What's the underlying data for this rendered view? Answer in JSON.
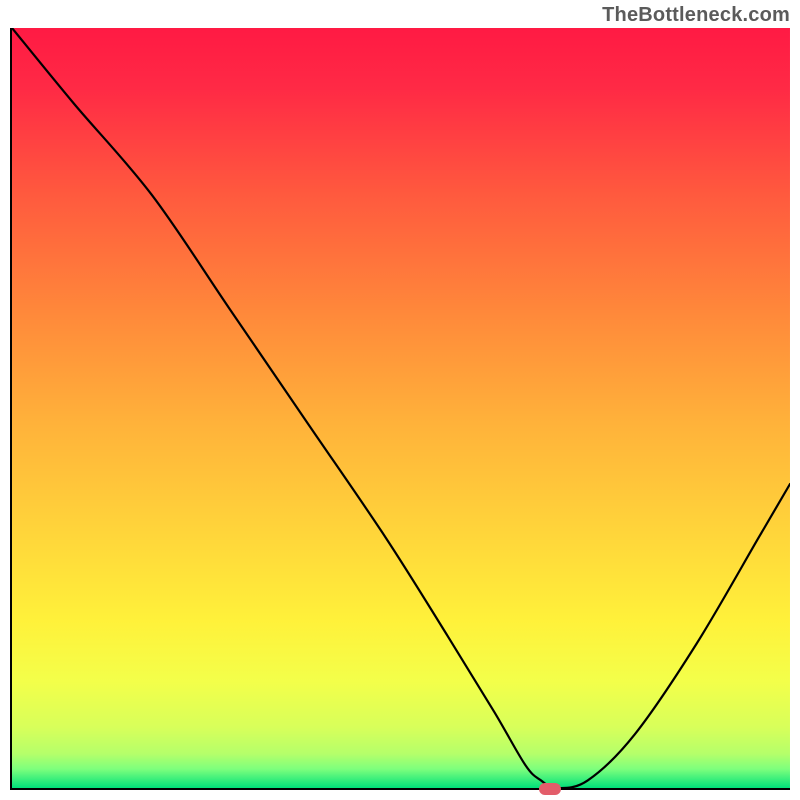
{
  "watermark": "TheBottleneck.com",
  "chart_data": {
    "type": "line",
    "title": "",
    "xlabel": "",
    "ylabel": "",
    "xlim": [
      0,
      100
    ],
    "ylim": [
      0,
      100
    ],
    "x": [
      0,
      8,
      18,
      28,
      38,
      48,
      56,
      62,
      66,
      68,
      70,
      74,
      80,
      88,
      96,
      100
    ],
    "values": [
      100,
      90,
      78,
      63,
      48,
      33,
      20,
      10,
      3,
      1,
      0,
      1,
      7,
      19,
      33,
      40
    ],
    "curve_smoothness": "smooth",
    "gradient_stops": [
      {
        "pos": 0.0,
        "color": "#ff1a44"
      },
      {
        "pos": 0.08,
        "color": "#ff2a45"
      },
      {
        "pos": 0.22,
        "color": "#ff5a3e"
      },
      {
        "pos": 0.38,
        "color": "#ff8a3a"
      },
      {
        "pos": 0.52,
        "color": "#ffb23a"
      },
      {
        "pos": 0.66,
        "color": "#ffd43a"
      },
      {
        "pos": 0.78,
        "color": "#fff13a"
      },
      {
        "pos": 0.86,
        "color": "#f3ff4a"
      },
      {
        "pos": 0.92,
        "color": "#d8ff5a"
      },
      {
        "pos": 0.955,
        "color": "#b5ff6a"
      },
      {
        "pos": 0.975,
        "color": "#7dff7d"
      },
      {
        "pos": 1.0,
        "color": "#00e07a"
      }
    ],
    "marker": {
      "x": 69,
      "y": 0,
      "color": "#e35d6a"
    }
  }
}
